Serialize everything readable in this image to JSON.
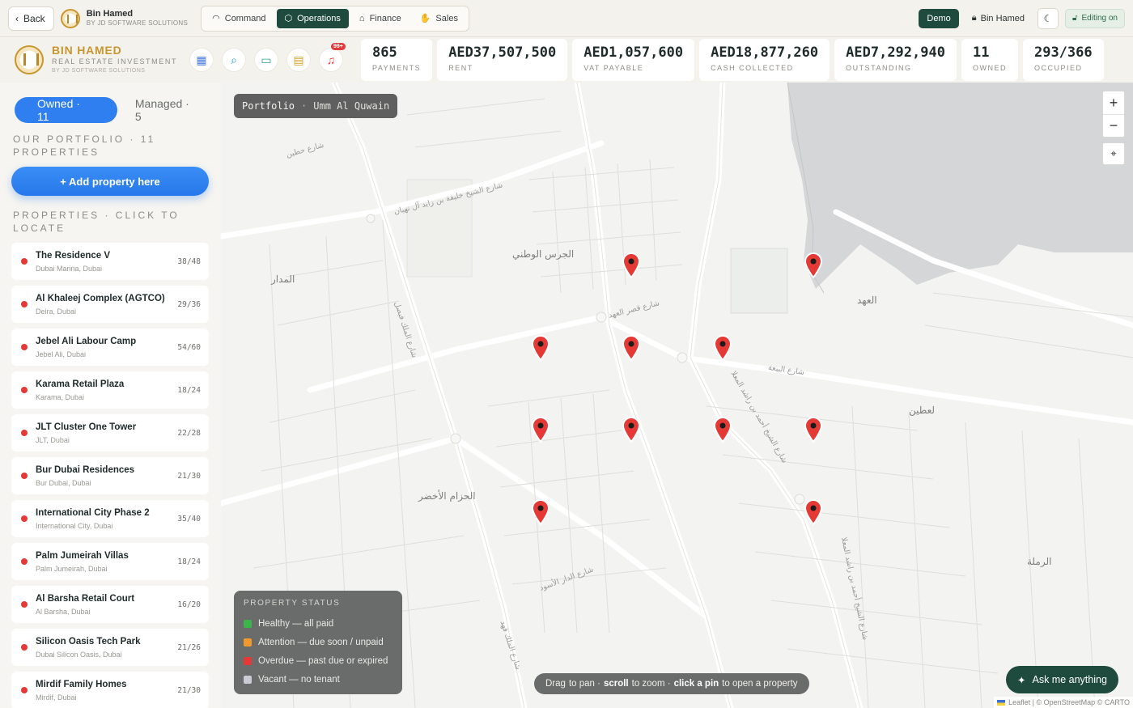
{
  "topbar": {
    "back_label": "Back",
    "brand_name": "Bin Hamed",
    "brand_sub": "BY JD SOFTWARE SOLUTIONS",
    "tabs": [
      {
        "label": "Command",
        "icon": "gauge-icon",
        "active": false
      },
      {
        "label": "Operations",
        "icon": "cube-icon",
        "active": true
      },
      {
        "label": "Finance",
        "icon": "bank-icon",
        "active": false
      },
      {
        "label": "Sales",
        "icon": "handshake-icon",
        "active": false
      }
    ],
    "demo_label": "Demo",
    "user_label": "Bin Hamed",
    "editing_label": "Editing on"
  },
  "brand": {
    "name": "BIN HAMED",
    "tagline": "REAL ESTATE INVESTMENT",
    "sub": "BY JD SOFTWARE SOLUTIONS",
    "notification_badge": "99+"
  },
  "stats": [
    {
      "value": "865",
      "label": "PAYMENTS"
    },
    {
      "value": "AED37,507,500",
      "label": "RENT"
    },
    {
      "value": "AED1,057,600",
      "label": "VAT PAYABLE"
    },
    {
      "value": "AED18,877,260",
      "label": "CASH COLLECTED"
    },
    {
      "value": "AED7,292,940",
      "label": "OUTSTANDING"
    },
    {
      "value": "11",
      "label": "OWNED"
    },
    {
      "value": "293/366",
      "label": "OCCUPIED"
    }
  ],
  "sidebar": {
    "tab_owned": "Owned · 11",
    "tab_managed": "Managed · 5",
    "portfolio_title": "OUR PORTFOLIO · 11 PROPERTIES",
    "add_button": "+ Add property here",
    "list_title": "PROPERTIES · CLICK TO LOCATE",
    "properties": [
      {
        "name": "The Residence V",
        "area": "Dubai Marina, Dubai",
        "occ": "38/48"
      },
      {
        "name": "Al Khaleej Complex (AGTCO)",
        "area": "Deira, Dubai",
        "occ": "29/36"
      },
      {
        "name": "Jebel Ali Labour Camp",
        "area": "Jebel Ali, Dubai",
        "occ": "54/60"
      },
      {
        "name": "Karama Retail Plaza",
        "area": "Karama, Dubai",
        "occ": "18/24"
      },
      {
        "name": "JLT Cluster One Tower",
        "area": "JLT, Dubai",
        "occ": "22/28"
      },
      {
        "name": "Bur Dubai Residences",
        "area": "Bur Dubai, Dubai",
        "occ": "21/30"
      },
      {
        "name": "International City Phase 2",
        "area": "International City, Dubai",
        "occ": "35/40"
      },
      {
        "name": "Palm Jumeirah Villas",
        "area": "Palm Jumeirah, Dubai",
        "occ": "18/24"
      },
      {
        "name": "Al Barsha Retail Court",
        "area": "Al Barsha, Dubai",
        "occ": "16/20"
      },
      {
        "name": "Silicon Oasis Tech Park",
        "area": "Dubai Silicon Oasis, Dubai",
        "occ": "21/26"
      },
      {
        "name": "Mirdif Family Homes",
        "area": "Mirdif, Dubai",
        "occ": "21/30"
      }
    ]
  },
  "map": {
    "portfolio_label": "Portfolio",
    "city_label": "Umm Al Quwain",
    "zoom_in": "+",
    "zoom_out": "−",
    "pin_color": "#e53935",
    "place_names": [
      "الجرس الوطني",
      "المدار",
      "العهد",
      "لعطين",
      "الحزام الأخضر",
      "الرملة"
    ],
    "street_names": [
      "شارع الشيخ خليفة بن زايد آل نهيان",
      "شارع قصر العهد",
      "شارع البيعة",
      "شارع الملك فيصل",
      "شارع الشيخ أحمد بن راشد المعلا",
      "شارع الشيخ أحمد بن راشد المعلا",
      "شارع الدار الأسود",
      "شارع حطين",
      "شارع الملك فهد"
    ],
    "legend": {
      "title": "PROPERTY STATUS",
      "items": [
        {
          "label": "Healthy — all paid",
          "color": "#3bb54a"
        },
        {
          "label": "Attention — due soon / unpaid",
          "color": "#f29a2e"
        },
        {
          "label": "Overdue — past due or expired",
          "color": "#e53935"
        },
        {
          "label": "Vacant — no tenant",
          "color": "#c9ccd4"
        }
      ]
    },
    "hint": {
      "drag": "Drag",
      "to_pan": "to pan ·",
      "scroll": "scroll",
      "to_zoom": "to zoom ·",
      "click_pin": "click a pin",
      "to_open": "to open a property"
    },
    "ask_label": "Ask me anything",
    "attribution": "Leaflet | © OpenStreetMap © CARTO"
  }
}
